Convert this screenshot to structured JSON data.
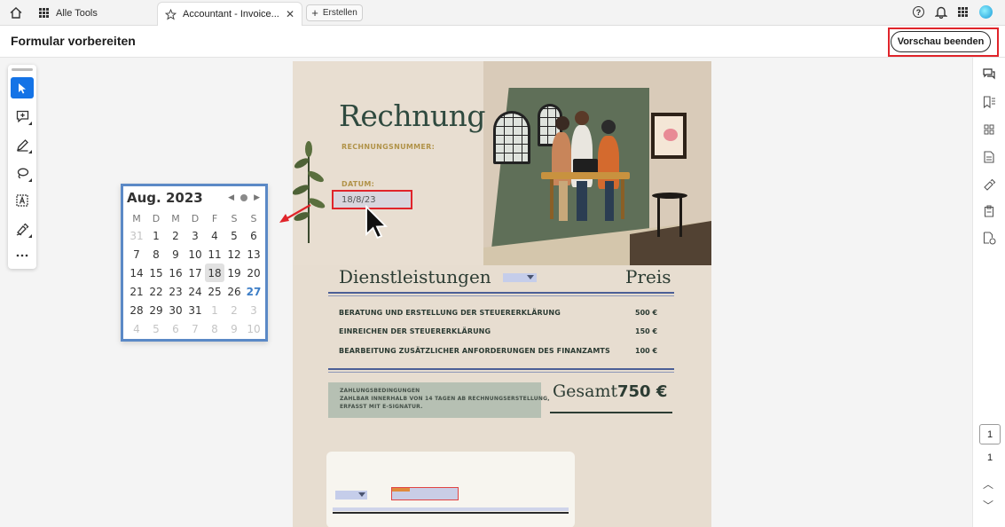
{
  "tabbar": {
    "all_tools": "Alle Tools",
    "tab_title": "Accountant - Invoice...",
    "tab_close": "✕",
    "create": "Erstellen",
    "help": "?"
  },
  "header": {
    "title": "Formular vorbereiten",
    "end_preview": "Vorschau beenden"
  },
  "document": {
    "heading": "Rechnung",
    "invoice_number_label": "RECHNUNGSNUMMER:",
    "date_label": "DATUM:",
    "date_value": "18/8/23",
    "services_heading": "Dienstleistungen",
    "price_heading": "Preis",
    "services": [
      {
        "name": "BERATUNG UND ERSTELLUNG DER STEUERERKLÄRUNG",
        "price": "500 €"
      },
      {
        "name": "EINREICHEN DER STEUERERKLÄRUNG",
        "price": "150 €"
      },
      {
        "name": "BEARBEITUNG ZUSÄTZLICHER ANFORDERUNGEN DES FINANZAMTS",
        "price": "100 €"
      }
    ],
    "terms_title": "ZAHLUNGSBEDINGUNGEN",
    "terms_line1": "ZAHLBAR INNERHALB VON 14 TAGEN AB RECHNUNGSERSTELLUNG,",
    "terms_line2": "ERFASST MIT E-SIGNATUR.",
    "total_label": "Gesamt",
    "total_value": "750 €"
  },
  "calendar": {
    "month": "Aug. 2023",
    "weekdays": [
      "M",
      "D",
      "M",
      "D",
      "F",
      "S",
      "S"
    ],
    "weeks": [
      [
        "31",
        "1",
        "2",
        "3",
        "4",
        "5",
        "6"
      ],
      [
        "7",
        "8",
        "9",
        "10",
        "11",
        "12",
        "13"
      ],
      [
        "14",
        "15",
        "16",
        "17",
        "18",
        "19",
        "20"
      ],
      [
        "21",
        "22",
        "23",
        "24",
        "25",
        "26",
        "27"
      ],
      [
        "28",
        "29",
        "30",
        "31",
        "1",
        "2",
        "3"
      ],
      [
        "4",
        "5",
        "6",
        "7",
        "8",
        "9",
        "10"
      ]
    ],
    "selected": "18",
    "today": "27"
  },
  "page_nav": {
    "current_page": "1",
    "total_pages": "1"
  },
  "colors": {
    "accent": "#1473e6",
    "highlight": "#e0242a",
    "calendar_border": "#5b89c6"
  },
  "icons": {
    "left_tools": [
      "select-arrow-icon",
      "add-comment-icon",
      "pen-icon",
      "lasso-icon",
      "text-field-icon",
      "signature-icon",
      "more-icon"
    ],
    "right_tools": [
      "comments-icon",
      "bookmarks-icon",
      "thumbnails-icon",
      "document-icon",
      "fill-sign-icon",
      "clipboard-icon",
      "protect-icon"
    ]
  }
}
